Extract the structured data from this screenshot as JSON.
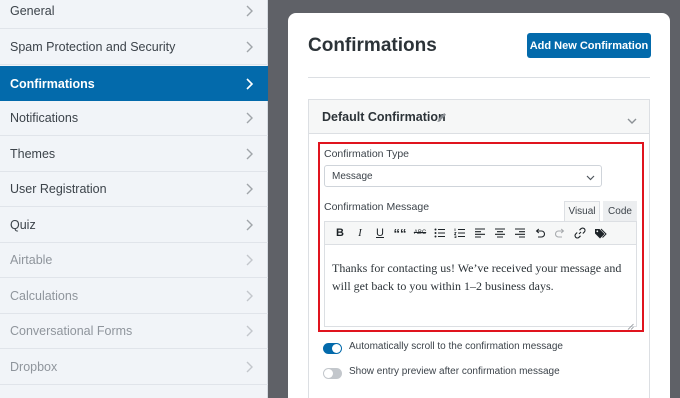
{
  "sidebar": {
    "items": [
      {
        "label": "General",
        "state": "normal"
      },
      {
        "label": "Spam Protection and Security",
        "state": "normal"
      },
      {
        "label": "Confirmations",
        "state": "active"
      },
      {
        "label": "Notifications",
        "state": "normal"
      },
      {
        "label": "Themes",
        "state": "normal"
      },
      {
        "label": "User Registration",
        "state": "normal"
      },
      {
        "label": "Quiz",
        "state": "normal"
      },
      {
        "label": "Airtable",
        "state": "muted"
      },
      {
        "label": "Calculations",
        "state": "muted"
      },
      {
        "label": "Conversational Forms",
        "state": "muted"
      },
      {
        "label": "Dropbox",
        "state": "muted"
      }
    ]
  },
  "main": {
    "title": "Confirmations",
    "add_button": "Add New Confirmation",
    "card": {
      "title": "Default Confirmation",
      "type_label": "Confirmation Type",
      "type_value": "Message",
      "message_label": "Confirmation Message",
      "tabs": {
        "visual": "Visual",
        "code": "Code"
      },
      "toolbar": {
        "bold": "B",
        "italic": "I",
        "underline": "U",
        "quote": "““",
        "strike": "ABC"
      },
      "message_text": "Thanks for contacting us! We’ve received your message and will get back to you within 1–2 business days.",
      "toggles": [
        {
          "label": "Automatically scroll to the confirmation message",
          "on": true
        },
        {
          "label": "Show entry preview after confirmation message",
          "on": false
        }
      ]
    }
  },
  "colors": {
    "accent": "#036aab",
    "highlight": "#e0141e",
    "backdrop": "#5f6167"
  }
}
